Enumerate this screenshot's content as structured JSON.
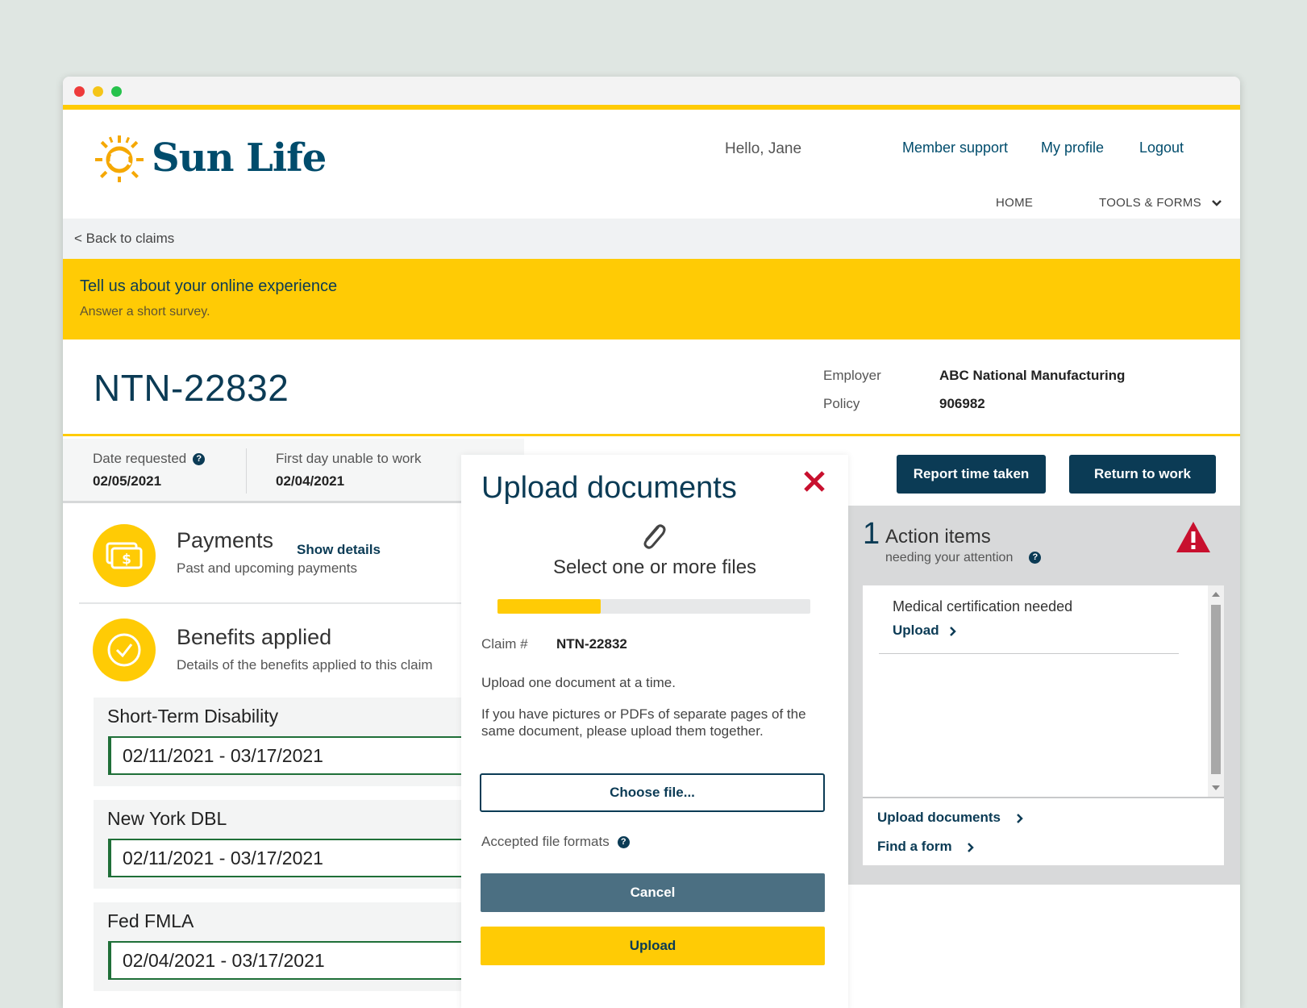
{
  "header": {
    "brand": "Sun Life",
    "greeting": "Hello, Jane",
    "links": {
      "member_support": "Member support",
      "my_profile": "My profile",
      "logout": "Logout"
    },
    "nav": {
      "home": "HOME",
      "tools_forms": "TOOLS & FORMS"
    }
  },
  "back_link": "<  Back to claims",
  "survey": {
    "title": "Tell us about your online experience",
    "subtitle": "Answer a short survey."
  },
  "claim": {
    "id": "NTN-22832",
    "employer_label": "Employer",
    "employer_value": "ABC National Manufacturing",
    "policy_label": "Policy",
    "policy_value": "906982"
  },
  "dates": {
    "requested_label": "Date requested",
    "requested_value": "02/05/2021",
    "first_day_label": "First day unable to work",
    "first_day_value": "02/04/2021"
  },
  "payments": {
    "title": "Payments",
    "show_details": "Show details",
    "subtitle": "Past and upcoming payments"
  },
  "benefits": {
    "title": "Benefits applied",
    "subtitle": "Details of the benefits applied to this claim",
    "items": [
      {
        "name": "Short-Term Disability",
        "range": "02/11/2021 - 03/17/2021"
      },
      {
        "name": "New York DBL",
        "range": "02/11/2021 - 03/17/2021"
      },
      {
        "name": "Fed FMLA",
        "range": "02/04/2021 - 03/17/2021"
      }
    ]
  },
  "actions": {
    "report_time": "Report time taken",
    "return_to_work": "Return to work"
  },
  "action_items": {
    "count": "1",
    "title": "Action items",
    "subtitle": "needing your attention",
    "items": [
      {
        "title": "Medical certification needed",
        "link": "Upload"
      }
    ],
    "links": {
      "upload_documents": "Upload documents",
      "find_form": "Find a form"
    }
  },
  "modal": {
    "title": "Upload documents",
    "select_files": "Select one or more files",
    "progress_fraction": 0.33,
    "claim_label": "Claim #",
    "claim_value": "NTN-22832",
    "instruction_1": "Upload one document at a time.",
    "instruction_2": "If you have pictures or PDFs of separate pages of the same document, please upload them together.",
    "choose_file": "Choose file...",
    "accepted_formats": "Accepted file formats",
    "cancel": "Cancel",
    "upload": "Upload"
  },
  "colors": {
    "brand_yellow": "#ffcb05",
    "brand_navy": "#0b3b55",
    "alert_red": "#c8102e",
    "benefit_green": "#1f6f38"
  }
}
